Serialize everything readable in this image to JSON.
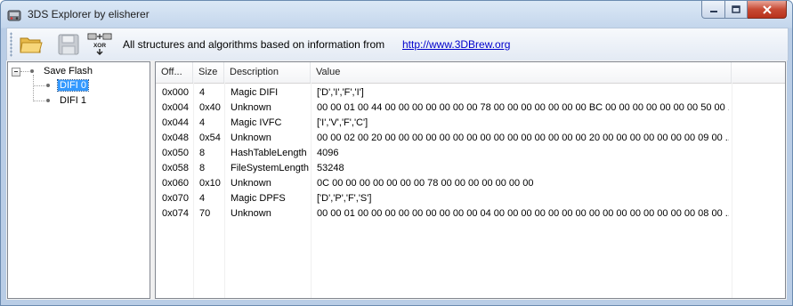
{
  "window": {
    "title": "3DS Explorer by elisherer"
  },
  "toolbar": {
    "open_icon": "folder-open-icon",
    "save_icon": "floppy-disk-icon",
    "xor_icon": "xor-tool-icon",
    "xor_label": "XOR",
    "info_text": "All structures and algorithms based on information from",
    "link_text": "http://www.3DBrew.org"
  },
  "tree": {
    "root": {
      "label": "Save Flash"
    },
    "children": [
      {
        "label": "DIFI 0",
        "selected": true
      },
      {
        "label": "DIFI 1",
        "selected": false
      }
    ]
  },
  "list": {
    "columns": [
      "Off...",
      "Size",
      "Description",
      "Value"
    ],
    "rows": [
      {
        "offset": "0x000",
        "size": "4",
        "description": "Magic DIFI",
        "value": "['D','I','F','I']"
      },
      {
        "offset": "0x004",
        "size": "0x40",
        "description": "Unknown",
        "value": "00 00 01 00 44 00 00 00 00 00 00 00 78 00 00 00 00 00 00 00 BC 00 00 00 00 00 00 00 50 00 ..."
      },
      {
        "offset": "0x044",
        "size": "4",
        "description": "Magic IVFC",
        "value": "['I','V','F','C']"
      },
      {
        "offset": "0x048",
        "size": "0x54",
        "description": "Unknown",
        "value": "00 00 02 00 20 00 00 00 00 00 00 00 00 00 00 00 00 00 00 00 20 00 00 00 00 00 00 00 09 00 ..."
      },
      {
        "offset": "0x050",
        "size": "8",
        "description": "HashTableLength",
        "value": "4096"
      },
      {
        "offset": "0x058",
        "size": "8",
        "description": "FileSystemLength",
        "value": "53248"
      },
      {
        "offset": "0x060",
        "size": "0x10",
        "description": "Unknown",
        "value": "0C 00 00 00 00 00 00 00 78 00 00 00 00 00 00 00"
      },
      {
        "offset": "0x070",
        "size": "4",
        "description": "Magic DPFS",
        "value": "['D','P','F','S']"
      },
      {
        "offset": "0x074",
        "size": "70",
        "description": "Unknown",
        "value": "00 00 01 00 00 00 00 00 00 00 00 00 04 00 00 00 00 00 00 00 00 00 00 00 00 00 00 00 08 00 ..."
      }
    ]
  },
  "colors": {
    "selection": "#3399ff",
    "link": "#0000cc",
    "close_button": "#c74a34"
  }
}
